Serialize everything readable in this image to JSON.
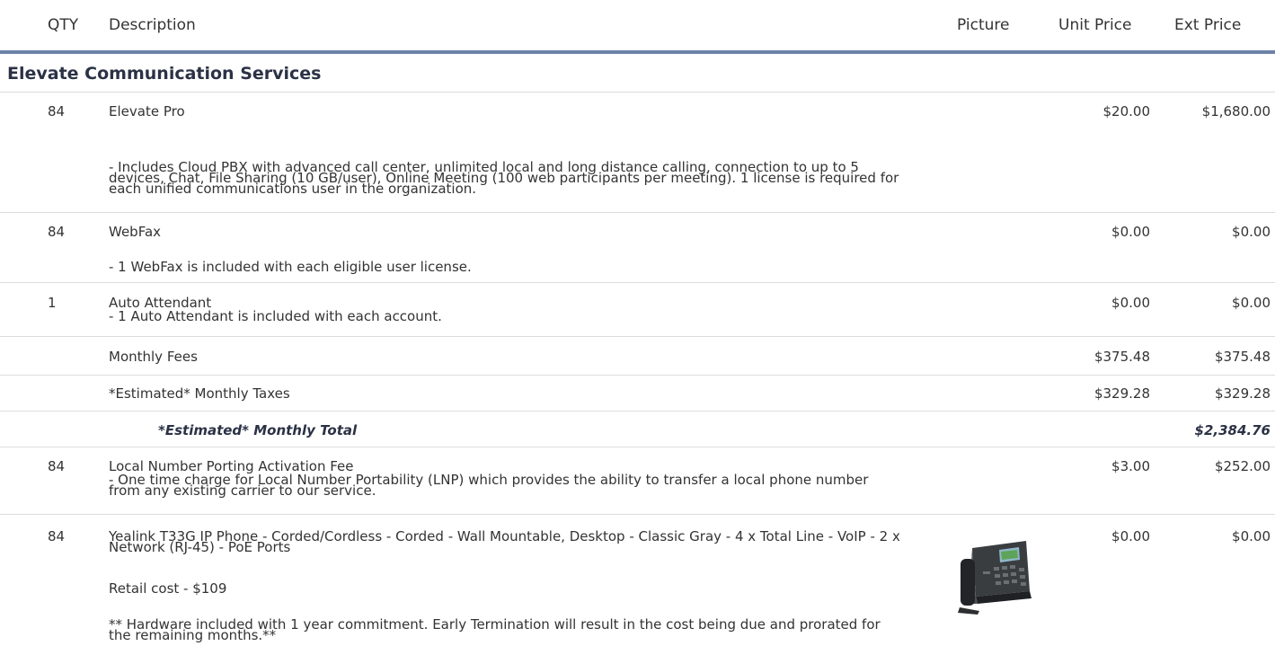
{
  "header": {
    "qty": "QTY",
    "description": "Description",
    "picture": "Picture",
    "unit_price": "Unit Price",
    "ext_price": "Ext Price"
  },
  "section_title": "Elevate Communication Services",
  "items": [
    {
      "qty": "84",
      "name": "Elevate Pro",
      "details": "- Includes Cloud PBX with advanced call center, unlimited local and long distance calling, connection to up to 5 devices, Chat, File Sharing (10 GB/user), Online Meeting (100 web participants per meeting). 1 license is required for each unified communications user in the organization.",
      "unit_price": "$20.00",
      "ext_price": "$1,680.00"
    },
    {
      "qty": "84",
      "name": "WebFax",
      "details": "- 1 WebFax is included with each eligible user license.",
      "unit_price": "$0.00",
      "ext_price": "$0.00"
    },
    {
      "qty": "1",
      "name": "Auto Attendant",
      "details": "- 1 Auto Attendant is included with each account.",
      "unit_price": "$0.00",
      "ext_price": "$0.00"
    }
  ],
  "fees": [
    {
      "label": "Monthly Fees",
      "unit_price": "$375.48",
      "ext_price": "$375.48"
    },
    {
      "label": "*Estimated* Monthly Taxes",
      "unit_price": "$329.28",
      "ext_price": "$329.28"
    }
  ],
  "monthly_total": {
    "label": "*Estimated* Monthly Total",
    "value": "$2,384.76"
  },
  "one_time_items": [
    {
      "qty": "84",
      "name": "Local Number Porting Activation Fee",
      "details": "- One time charge for Local Number Portability (LNP) which provides the ability to transfer a local phone number from any existing carrier to our service.",
      "unit_price": "$3.00",
      "ext_price": "$252.00"
    },
    {
      "qty": "84",
      "name": "Yealink T33G IP Phone - Corded/Cordless - Corded - Wall Mountable, Desktop - Classic Gray - 4 x Total Line - VoIP - 2 x Network (RJ-45) - PoE Ports",
      "retail": "Retail cost - $109",
      "note": "** Hardware included with 1 year commitment. Early Termination will result in the cost being due and prorated for the remaining months.**",
      "unit_price": "$0.00",
      "ext_price": "$0.00"
    }
  ]
}
